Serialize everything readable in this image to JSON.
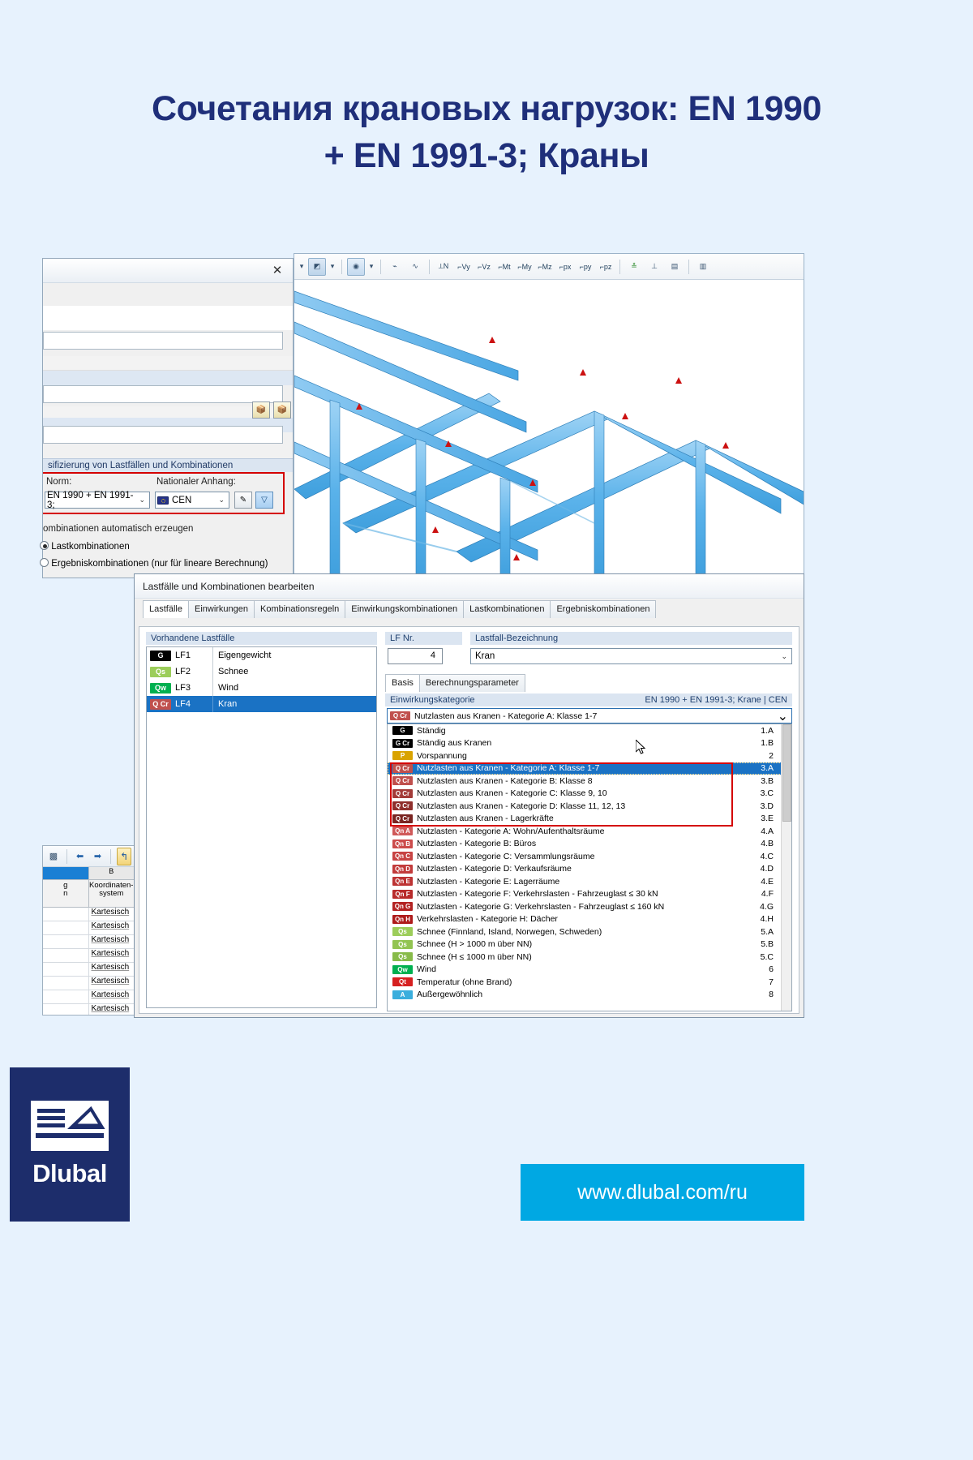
{
  "page": {
    "title_line1": "Сочетания крановых нагрузок: EN 1990",
    "title_line2": "+ EN 1991-3; Краны",
    "bg_color": "#e7f2fd",
    "title_color": "#1f2f7a"
  },
  "left_dialog": {
    "close_icon": "✕",
    "group_header": "sifizierung von Lastfällen und Kombinationen",
    "norm_label": "Norm:",
    "norm_value": "EN 1990 + EN 1991-3;",
    "annex_label": "Nationaler Anhang:",
    "annex_value": "CEN",
    "annex_flag_icon": "eu-flag-icon",
    "edit_annex_icon": "edit-icon",
    "filter_icon": "funnel-icon",
    "auto_label": "ombinationen automatisch erzeugen",
    "radio1_label": "Lastkombinationen",
    "radio2_label": "Ergebniskombinationen (nur für lineare Berechnung)",
    "new_icon": "new-object-icon",
    "dup_icon": "duplicate-icon"
  },
  "rfem_toolbar": {
    "items": [
      {
        "icon": "dropdown-arrow-icon",
        "label": "▾"
      },
      {
        "icon": "render-mode-icon",
        "label": "⬓"
      },
      {
        "icon": "dropdown-arrow-icon",
        "label": "▾"
      },
      {
        "icon": "globe-icon",
        "label": "◎"
      },
      {
        "icon": "dropdown-arrow-icon",
        "label": "▾"
      },
      {
        "icon": "deformation-icon",
        "label": "∕∕"
      },
      {
        "icon": "curve-icon",
        "label": "∿"
      },
      {
        "icon": "axial-force-n-icon",
        "label": "N"
      },
      {
        "icon": "shear-vy-icon",
        "label": "Vy"
      },
      {
        "icon": "shear-vz-icon",
        "label": "Vz"
      },
      {
        "icon": "torsion-mt-icon",
        "label": "Mt"
      },
      {
        "icon": "moment-my-icon",
        "label": "My"
      },
      {
        "icon": "moment-mz-icon",
        "label": "Mz"
      },
      {
        "icon": "px-icon",
        "label": "px"
      },
      {
        "icon": "py-icon",
        "label": "py"
      },
      {
        "icon": "pz-icon",
        "label": "pz"
      },
      {
        "icon": "result-values-icon",
        "label": "≛"
      },
      {
        "icon": "sections-icon",
        "label": "⊥"
      },
      {
        "icon": "result-table-icon",
        "label": "▦"
      },
      {
        "icon": "print-icon",
        "label": "🖶"
      }
    ]
  },
  "spreadsheet": {
    "toolbar_icons": [
      "diagram-icon",
      "prev-icon",
      "next-icon",
      "undo-icon"
    ],
    "col_a_header": "",
    "col_b_header": "B",
    "sub_a_line1": "g",
    "sub_a_line2": "n",
    "sub_b_line1": "Koordinaten-",
    "sub_b_line2": "system",
    "rows": [
      {
        "a": "",
        "b": "Kartesisch"
      },
      {
        "a": "",
        "b": "Kartesisch"
      },
      {
        "a": "",
        "b": "Kartesisch"
      },
      {
        "a": "",
        "b": "Kartesisch"
      },
      {
        "a": "",
        "b": "Kartesisch"
      },
      {
        "a": "",
        "b": "Kartesisch"
      },
      {
        "a": "",
        "b": "Kartesisch"
      },
      {
        "a": "",
        "b": "Kartesisch"
      }
    ]
  },
  "main_dialog": {
    "title": "Lastfälle und Kombinationen bearbeiten",
    "tabs": [
      {
        "label": "Lastfälle",
        "active": true
      },
      {
        "label": "Einwirkungen",
        "active": false
      },
      {
        "label": "Kombinationsregeln",
        "active": false
      },
      {
        "label": "Einwirkungskombinationen",
        "active": false
      },
      {
        "label": "Lastkombinationen",
        "active": false
      },
      {
        "label": "Ergebniskombinationen",
        "active": false
      }
    ],
    "left_panel_header": "Vorhandene Lastfälle",
    "load_cases": [
      {
        "tag": "G",
        "tag_bg": "#000000",
        "tag_fg": "#ffffff",
        "no": "LF1",
        "name": "Eigengewicht",
        "selected": false
      },
      {
        "tag": "Qs",
        "tag_bg": "#9ccd5a",
        "tag_fg": "#ffffff",
        "no": "LF2",
        "name": "Schnee",
        "selected": false
      },
      {
        "tag": "Qw",
        "tag_bg": "#00b050",
        "tag_fg": "#ffffff",
        "no": "LF3",
        "name": "Wind",
        "selected": false
      },
      {
        "tag": "Q Cr",
        "tag_bg": "#c0504d",
        "tag_fg": "#ffffff",
        "no": "LF4",
        "name": "Kran",
        "selected": true
      }
    ],
    "lf_nr_label": "LF Nr.",
    "lf_nr_value": "4",
    "lf_name_label": "Lastfall-Bezeichnung",
    "lf_name_value": "Kran",
    "inner_tabs": [
      {
        "label": "Basis",
        "active": true
      },
      {
        "label": "Berechnungsparameter",
        "active": false
      }
    ],
    "category_panel_label": "Einwirkungskategorie",
    "category_panel_right": "EN 1990 + EN 1991-3; Krane | CEN",
    "selected_category": {
      "tag": "Q Cr",
      "tag_bg": "#c0504d",
      "text": "Nutzlasten aus Kranen - Kategorie A: Klasse 1-7"
    },
    "categories": [
      {
        "tag": "G",
        "tag_bg": "#000000",
        "text": "Ständig",
        "code": "1.A",
        "selected": false,
        "boxed": false
      },
      {
        "tag": "G Cr",
        "tag_bg": "#000000",
        "text": "Ständig aus Kranen",
        "code": "1.B",
        "selected": false,
        "boxed": false
      },
      {
        "tag": "P",
        "tag_bg": "#d9a300",
        "text": "Vorspannung",
        "code": "2",
        "selected": false,
        "boxed": false
      },
      {
        "tag": "Q Cr",
        "tag_bg": "#c0504d",
        "text": "Nutzlasten aus Kranen - Kategorie A: Klasse 1-7",
        "code": "3.A",
        "selected": true,
        "boxed": true
      },
      {
        "tag": "Q Cr",
        "tag_bg": "#c0504d",
        "text": "Nutzlasten aus Kranen - Kategorie B: Klasse 8",
        "code": "3.B",
        "selected": false,
        "boxed": true
      },
      {
        "tag": "Q Cr",
        "tag_bg": "#a33b38",
        "text": "Nutzlasten aus Kranen - Kategorie C: Klasse 9, 10",
        "code": "3.C",
        "selected": false,
        "boxed": true
      },
      {
        "tag": "Q Cr",
        "tag_bg": "#8f2f2c",
        "text": "Nutzlasten aus Kranen - Kategorie D: Klasse 11, 12, 13",
        "code": "3.D",
        "selected": false,
        "boxed": true
      },
      {
        "tag": "Q Cr",
        "tag_bg": "#7a2522",
        "text": "Nutzlasten aus Kranen - Lagerkräfte",
        "code": "3.E",
        "selected": false,
        "boxed": true
      },
      {
        "tag": "Qn A",
        "tag_bg": "#d05a5a",
        "text": "Nutzlasten - Kategorie A: Wohn/Aufenthaltsräume",
        "code": "4.A",
        "selected": false,
        "boxed": false
      },
      {
        "tag": "Qn B",
        "tag_bg": "#cc4c4c",
        "text": "Nutzlasten - Kategorie B: Büros",
        "code": "4.B",
        "selected": false,
        "boxed": false
      },
      {
        "tag": "Qn C",
        "tag_bg": "#c74343",
        "text": "Nutzlasten - Kategorie C: Versammlungsräume",
        "code": "4.C",
        "selected": false,
        "boxed": false
      },
      {
        "tag": "Qn D",
        "tag_bg": "#c23b3b",
        "text": "Nutzlasten - Kategorie D: Verkaufsräume",
        "code": "4.D",
        "selected": false,
        "boxed": false
      },
      {
        "tag": "Qn E",
        "tag_bg": "#bd3333",
        "text": "Nutzlasten - Kategorie E: Lagerräume",
        "code": "4.E",
        "selected": false,
        "boxed": false
      },
      {
        "tag": "Qn F",
        "tag_bg": "#b82b2b",
        "text": "Nutzlasten - Kategorie F: Verkehrslasten - Fahrzeuglast ≤ 30 kN",
        "code": "4.F",
        "selected": false,
        "boxed": false
      },
      {
        "tag": "Qn G",
        "tag_bg": "#b32323",
        "text": "Nutzlasten - Kategorie G: Verkehrslasten - Fahrzeuglast ≤ 160 kN",
        "code": "4.G",
        "selected": false,
        "boxed": false
      },
      {
        "tag": "Qn H",
        "tag_bg": "#ae1b1b",
        "text": "Verkehrslasten - Kategorie H: Dächer",
        "code": "4.H",
        "selected": false,
        "boxed": false
      },
      {
        "tag": "Qs",
        "tag_bg": "#9ccd5a",
        "text": "Schnee (Finnland, Island, Norwegen, Schweden)",
        "code": "5.A",
        "selected": false,
        "boxed": false
      },
      {
        "tag": "Qs",
        "tag_bg": "#92c452",
        "text": "Schnee (H > 1000 m über NN)",
        "code": "5.B",
        "selected": false,
        "boxed": false
      },
      {
        "tag": "Qs",
        "tag_bg": "#88bb4a",
        "text": "Schnee (H ≤ 1000 m über NN)",
        "code": "5.C",
        "selected": false,
        "boxed": false
      },
      {
        "tag": "Qw",
        "tag_bg": "#00b050",
        "text": "Wind",
        "code": "6",
        "selected": false,
        "boxed": false
      },
      {
        "tag": "Qt",
        "tag_bg": "#d62020",
        "text": "Temperatur (ohne Brand)",
        "code": "7",
        "selected": false,
        "boxed": false
      },
      {
        "tag": "A",
        "tag_bg": "#3aaedd",
        "text": "Außergewöhnlich",
        "code": "8",
        "selected": false,
        "boxed": false
      }
    ]
  },
  "footer": {
    "logo_text": "Dlubal",
    "logo_icon": "dlubal-logo-icon",
    "url": "www.dlubal.com/ru",
    "url_bg": "#00a8e3",
    "logo_bg": "#1d2d6b"
  }
}
